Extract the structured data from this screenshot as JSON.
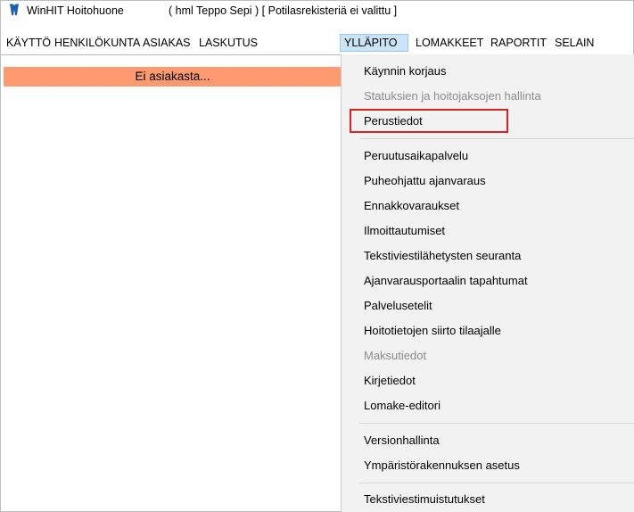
{
  "titlebar": {
    "app_title": "WinHIT Hoitohuone",
    "info": "( hml Teppo Sepi )  [ Potilasrekisteriä ei valittu ]"
  },
  "menubar": {
    "items": [
      {
        "label": "KÄYTTÖ"
      },
      {
        "label": "HENKILÖKUNTA"
      },
      {
        "label": "ASIAKAS"
      },
      {
        "label": "LASKUTUS"
      },
      {
        "label": "YLLÄPITO"
      },
      {
        "label": "LOMAKKEET"
      },
      {
        "label": "RAPORTIT"
      },
      {
        "label": "SELAIN"
      }
    ],
    "active_index": 4
  },
  "left_panel": {
    "banner": "Ei asiakasta..."
  },
  "dropdown": {
    "items": [
      {
        "label": "Käynnin korjaus",
        "enabled": true
      },
      {
        "label": "Statuksien ja hoitojaksojen hallinta",
        "enabled": false
      },
      {
        "label": "Perustiedot",
        "enabled": true,
        "highlighted": true
      },
      {
        "label": "Peruutusaikapalvelu",
        "enabled": true
      },
      {
        "label": "Puheohjattu ajanvaraus",
        "enabled": true
      },
      {
        "label": "Ennakkovaraukset",
        "enabled": true
      },
      {
        "label": "Ilmoittautumiset",
        "enabled": true
      },
      {
        "label": "Tekstiviestilähetysten seuranta",
        "enabled": true
      },
      {
        "label": "Ajanvarausportaalin tapahtumat",
        "enabled": true
      },
      {
        "label": "Palvelusetelit",
        "enabled": true
      },
      {
        "label": "Hoitotietojen siirto tilaajalle",
        "enabled": true
      },
      {
        "label": "Maksutiedot",
        "enabled": false
      },
      {
        "label": "Kirjetiedot",
        "enabled": true
      },
      {
        "label": "Lomake-editori",
        "enabled": true
      },
      {
        "label": "Versionhallinta",
        "enabled": true
      },
      {
        "label": "Ympäristörakennuksen asetus",
        "enabled": true
      },
      {
        "label": "Tekstiviestimuistutukset",
        "enabled": true
      }
    ]
  },
  "colors": {
    "banner_bg": "#fd9a6f",
    "menu_active_bg": "#cce4f7",
    "dropdown_bg": "#f2f2f2",
    "highlight_border": "#e02020",
    "disabled_text": "#8c8c8c"
  }
}
